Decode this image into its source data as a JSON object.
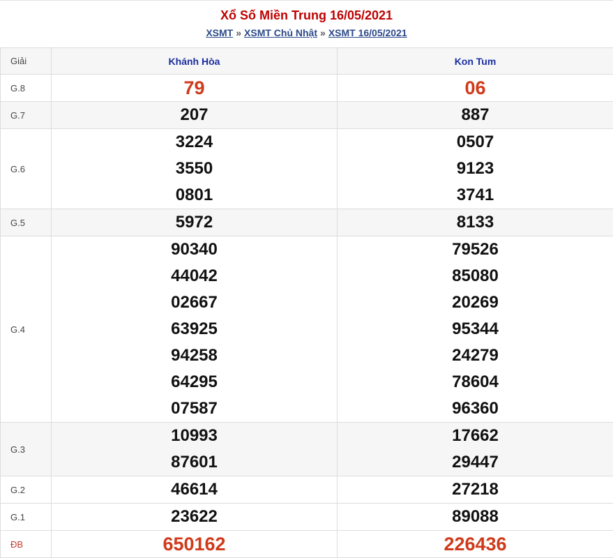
{
  "header": {
    "title": "Xổ Số Miền Trung 16/05/2021",
    "breadcrumb": [
      {
        "label": "XSMT"
      },
      {
        "label": "XSMT Chủ Nhật"
      },
      {
        "label": "XSMT 16/05/2021"
      }
    ],
    "separator": "»"
  },
  "table": {
    "giai_header": "Giải",
    "provinces": [
      "Khánh Hòa",
      "Kon Tum"
    ],
    "rows": [
      {
        "label": "G.8",
        "a": [
          "79"
        ],
        "b": [
          "06"
        ]
      },
      {
        "label": "G.7",
        "a": [
          "207"
        ],
        "b": [
          "887"
        ]
      },
      {
        "label": "G.6",
        "a": [
          "3224",
          "3550",
          "0801"
        ],
        "b": [
          "0507",
          "9123",
          "3741"
        ]
      },
      {
        "label": "G.5",
        "a": [
          "5972"
        ],
        "b": [
          "8133"
        ]
      },
      {
        "label": "G.4",
        "a": [
          "90340",
          "44042",
          "02667",
          "63925",
          "94258",
          "64295",
          "07587"
        ],
        "b": [
          "79526",
          "85080",
          "20269",
          "95344",
          "24279",
          "78604",
          "96360"
        ]
      },
      {
        "label": "G.3",
        "a": [
          "10993",
          "87601"
        ],
        "b": [
          "17662",
          "29447"
        ]
      },
      {
        "label": "G.2",
        "a": [
          "46614"
        ],
        "b": [
          "27218"
        ]
      },
      {
        "label": "G.1",
        "a": [
          "23622"
        ],
        "b": [
          "89088"
        ]
      },
      {
        "label": "ĐB",
        "a": [
          "650162"
        ],
        "b": [
          "226436"
        ]
      }
    ]
  },
  "colors": {
    "title": "#c00000",
    "province": "#1a2fa0",
    "highlight": "#d03a1a",
    "link": "#2b4a8a"
  }
}
